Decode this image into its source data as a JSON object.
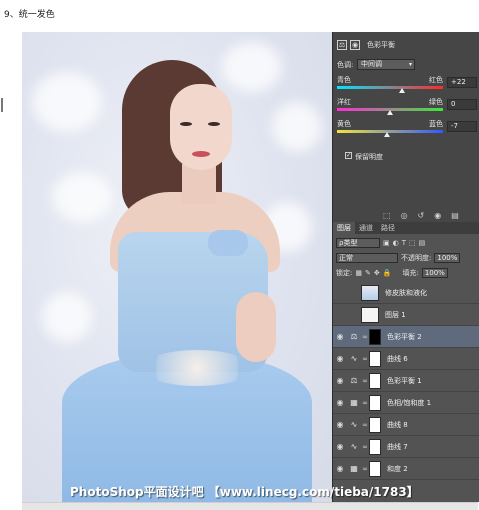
{
  "heading": "9、统一发色",
  "properties": {
    "title": "色彩平衡",
    "tone_label": "色调:",
    "tone_value": "中间调",
    "sliders": [
      {
        "left": "青色",
        "right": "红色",
        "value": "+22",
        "position": 0.61,
        "colors": [
          "#00e5ff",
          "#ff2a2a"
        ]
      },
      {
        "left": "洋红",
        "right": "绿色",
        "value": "0",
        "position": 0.5,
        "colors": [
          "#ff2bd6",
          "#38e83a"
        ]
      },
      {
        "left": "黄色",
        "right": "蓝色",
        "value": "-7",
        "position": 0.47,
        "colors": [
          "#f5e23a",
          "#2f5bff"
        ]
      }
    ],
    "preserve_luminosity": "保留明度",
    "preserve_checked": true
  },
  "layers_panel": {
    "tabs": [
      "图层",
      "通道",
      "路径"
    ],
    "active_tab": 0,
    "filter_label": "ρ类型",
    "blend_mode": "正常",
    "opacity_label": "不透明度:",
    "opacity_value": "100%",
    "lock_label": "锁定:",
    "fill_label": "填充:",
    "fill_value": "100%",
    "layers": [
      {
        "name": "修皮肤和液化",
        "kind": "pixel",
        "visible": false,
        "selected": false
      },
      {
        "name": "图层 1",
        "kind": "pixel",
        "visible": false,
        "selected": false
      },
      {
        "name": "色彩平衡 2",
        "kind": "balance-icon",
        "visible": true,
        "selected": true,
        "mask": "dark"
      },
      {
        "name": "曲线 6",
        "kind": "curves-icon",
        "visible": true,
        "selected": false,
        "mask": "white"
      },
      {
        "name": "色彩平衡 1",
        "kind": "balance-icon",
        "visible": true,
        "selected": false,
        "mask": "white"
      },
      {
        "name": "色相/饱和度 1",
        "kind": "hue-icon",
        "visible": true,
        "selected": false,
        "mask": "white"
      },
      {
        "name": "曲线 8",
        "kind": "curves-icon",
        "visible": true,
        "selected": false,
        "mask": "white"
      },
      {
        "name": "曲线 7",
        "kind": "curves-icon",
        "visible": true,
        "selected": false,
        "mask": "white"
      },
      {
        "name": "和度 2",
        "kind": "hue-icon",
        "visible": true,
        "selected": false,
        "mask": "white"
      }
    ]
  },
  "watermark": "PhotoShop平面设计吧 【www.linecg.com/tieba/1783】",
  "colors": {
    "panel_bg": "#535353",
    "properties_bg": "#464646",
    "selected_layer": "#5f6b7c",
    "dress": "#9fc2e6"
  }
}
